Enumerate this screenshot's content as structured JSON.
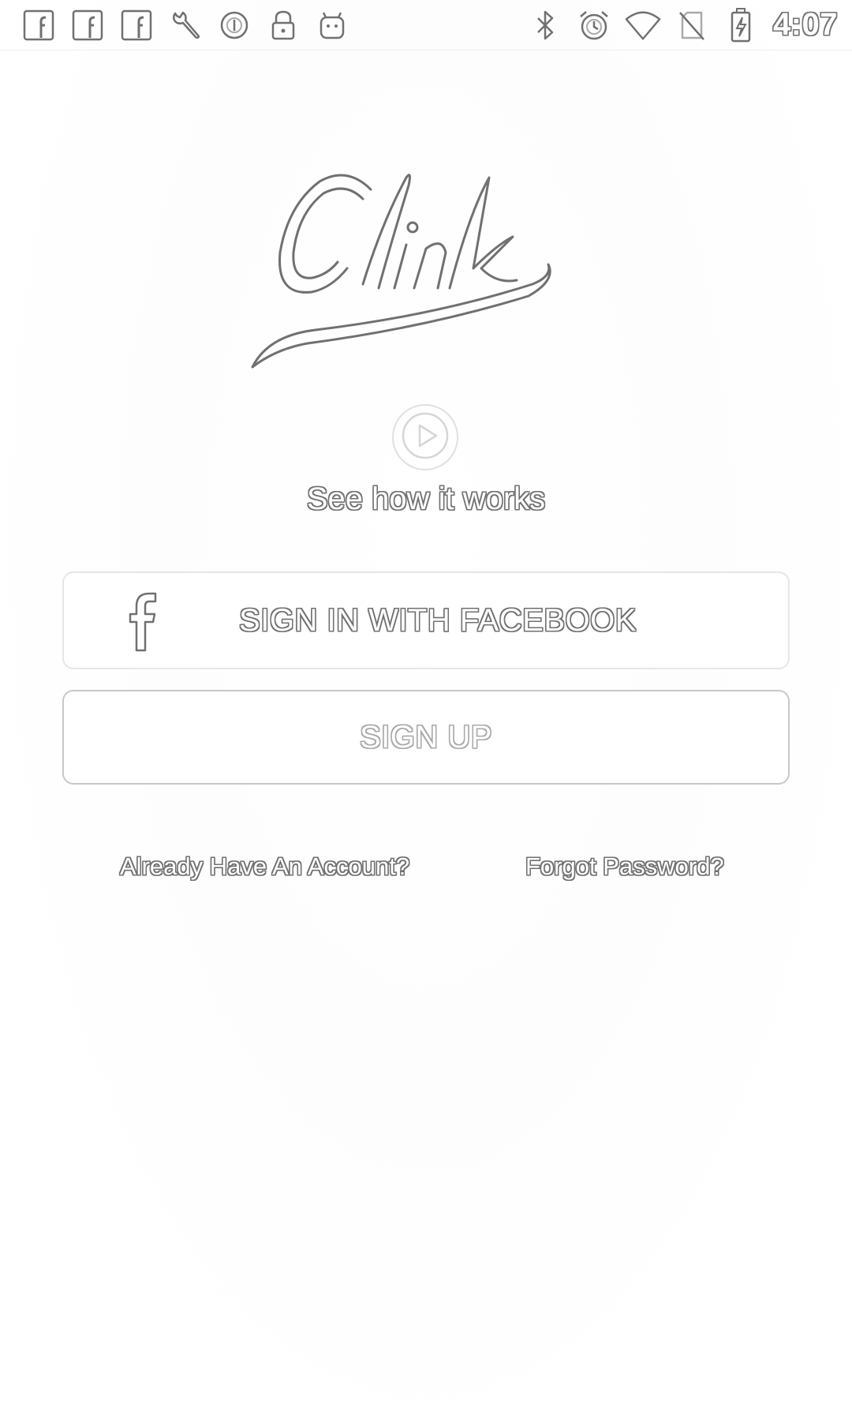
{
  "status_bar": {
    "left_icons": [
      "facebook-notification-icon",
      "facebook-notification-icon",
      "facebook-notification-icon",
      "wrench-icon",
      "sync-icon",
      "lock-icon",
      "android-icon"
    ],
    "right_icons": [
      "bluetooth-icon",
      "alarm-icon",
      "wifi-icon",
      "no-sim-icon",
      "battery-charging-icon"
    ],
    "time": "4:07"
  },
  "logo": {
    "text": "Clink"
  },
  "intro": {
    "see_how_label": "See how it works"
  },
  "buttons": {
    "facebook_label": "SIGN IN WITH FACEBOOK",
    "signup_label": "SIGN UP"
  },
  "links": {
    "account_label": "Already Have An Account?",
    "forgot_label": "Forgot Password?"
  },
  "colors": {
    "outline": "#707070",
    "border_light": "#e6e6e6",
    "border": "#c8c8c8",
    "background": "#ffffff"
  }
}
